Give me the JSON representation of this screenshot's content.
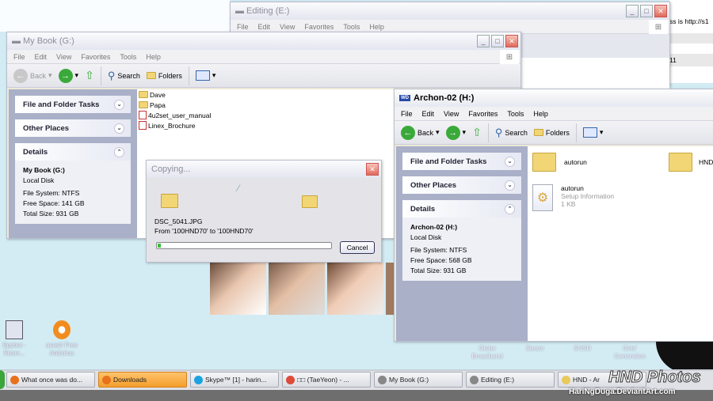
{
  "editing_window": {
    "title": "Editing (E:)",
    "menu": [
      "File",
      "Edit",
      "View",
      "Favorites",
      "Tools",
      "Help"
    ]
  },
  "background_page": {
    "text": "ss is  http://s1",
    "row_text": "11"
  },
  "mybook_window": {
    "title": "My Book (G:)",
    "menu": [
      "File",
      "Edit",
      "View",
      "Favorites",
      "Tools",
      "Help"
    ],
    "toolbar": {
      "back": "Back",
      "search": "Search",
      "folders": "Folders"
    },
    "panes": {
      "tasks": "File and Folder Tasks",
      "places": "Other Places",
      "details": "Details"
    },
    "details": {
      "name": "My Book (G:)",
      "type": "Local Disk",
      "fs": "File System: NTFS",
      "free": "Free Space: 141 GB",
      "total": "Total Size: 931 GB"
    },
    "files": [
      {
        "name": "Dave",
        "type": "folder"
      },
      {
        "name": "Papa",
        "type": "folder"
      },
      {
        "name": "4u2set_user_manual",
        "type": "pdf"
      },
      {
        "name": "Linex_Brochure",
        "type": "pdf"
      }
    ]
  },
  "copy_dialog": {
    "title": "Copying...",
    "filename": "DSC_5041.JPG",
    "from_to": "From '100HND70' to '100HND70'",
    "progress_percent": 1,
    "cancel": "Cancel"
  },
  "archon_window": {
    "title": "Archon-02 (H:)",
    "menu": [
      "File",
      "Edit",
      "View",
      "Favorites",
      "Tools",
      "Help"
    ],
    "toolbar": {
      "back": "Back",
      "search": "Search",
      "folders": "Folders"
    },
    "panes": {
      "tasks": "File and Folder Tasks",
      "places": "Other Places",
      "details": "Details"
    },
    "details": {
      "name": "Archon-02 (H:)",
      "type": "Local Disk",
      "fs": "File System: NTFS",
      "free": "Free Space: 568 GB",
      "total": "Total Size: 931 GB"
    },
    "files": [
      {
        "name": "autorun",
        "type": "folder"
      },
      {
        "name": "HND -",
        "type": "folder"
      },
      {
        "name": "autorun",
        "sub": "Setup Information",
        "size": "1 KB",
        "type": "inf"
      }
    ]
  },
  "desktop_icons": [
    {
      "label": "Spybot - Searc..."
    },
    {
      "label": "avast! Free Antivirus"
    }
  ],
  "desktop_labels": [
    "Globe Broadband",
    "Steam",
    "SNSD",
    "Girls' Generation"
  ],
  "taskbar": [
    {
      "label": "What once was do...",
      "color": "#e8711c"
    },
    {
      "label": "Downloads",
      "color": "#e8711c",
      "active": true
    },
    {
      "label": "Skype™ [1] - harin...",
      "color": "#1aa3e0"
    },
    {
      "label": "□□ (TaeYeon) - ...",
      "color": "#dd4b39"
    },
    {
      "label": "My Book (G:)",
      "color": "#888"
    },
    {
      "label": "Editing (E:)",
      "color": "#888"
    },
    {
      "label": "HND - Ar",
      "color": "#e8c95a"
    }
  ],
  "watermark": {
    "title": "HND Photos",
    "url": "HariNgDuga.DeviantArt.com"
  }
}
